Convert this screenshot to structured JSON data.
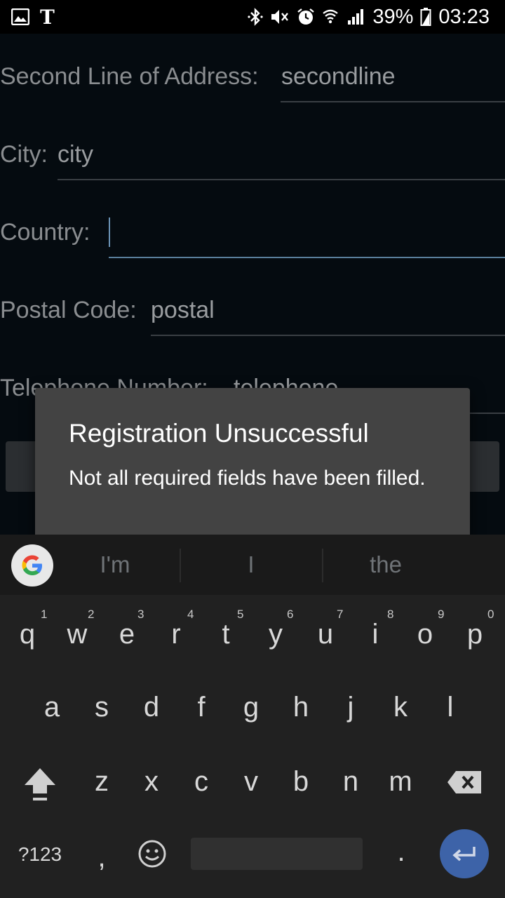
{
  "status_bar": {
    "left_icons": [
      "image-icon",
      "nytimes-icon"
    ],
    "right_icons": [
      "bluetooth-icon",
      "mute-icon",
      "alarm-icon",
      "wifi-icon",
      "signal-icon"
    ],
    "battery": "39%",
    "time": "03:23"
  },
  "form": {
    "second_line": {
      "label": "Second Line of Address:",
      "value": "secondline"
    },
    "city": {
      "label": "City:",
      "value": "city"
    },
    "country": {
      "label": "Country:",
      "value": ""
    },
    "postal": {
      "label": "Postal Code:",
      "value": "postal"
    },
    "telephone": {
      "label": "Telephone Number:",
      "value": "telephone"
    }
  },
  "dialog": {
    "title": "Registration Unsuccessful",
    "message": "Not all required fields have been filled."
  },
  "keyboard": {
    "suggestions": [
      "I'm",
      "I",
      "the"
    ],
    "row1": [
      "q",
      "w",
      "e",
      "r",
      "t",
      "y",
      "u",
      "i",
      "o",
      "p"
    ],
    "row1_hints": [
      "1",
      "2",
      "3",
      "4",
      "5",
      "6",
      "7",
      "8",
      "9",
      "0"
    ],
    "row2": [
      "a",
      "s",
      "d",
      "f",
      "g",
      "h",
      "j",
      "k",
      "l"
    ],
    "row3": [
      "z",
      "x",
      "c",
      "v",
      "b",
      "n",
      "m"
    ],
    "symbols_label": "?123",
    "comma": ",",
    "period": "."
  },
  "colors": {
    "accent": "#3d63a8",
    "dialog_bg": "#434343",
    "keyboard_bg": "#212121"
  }
}
